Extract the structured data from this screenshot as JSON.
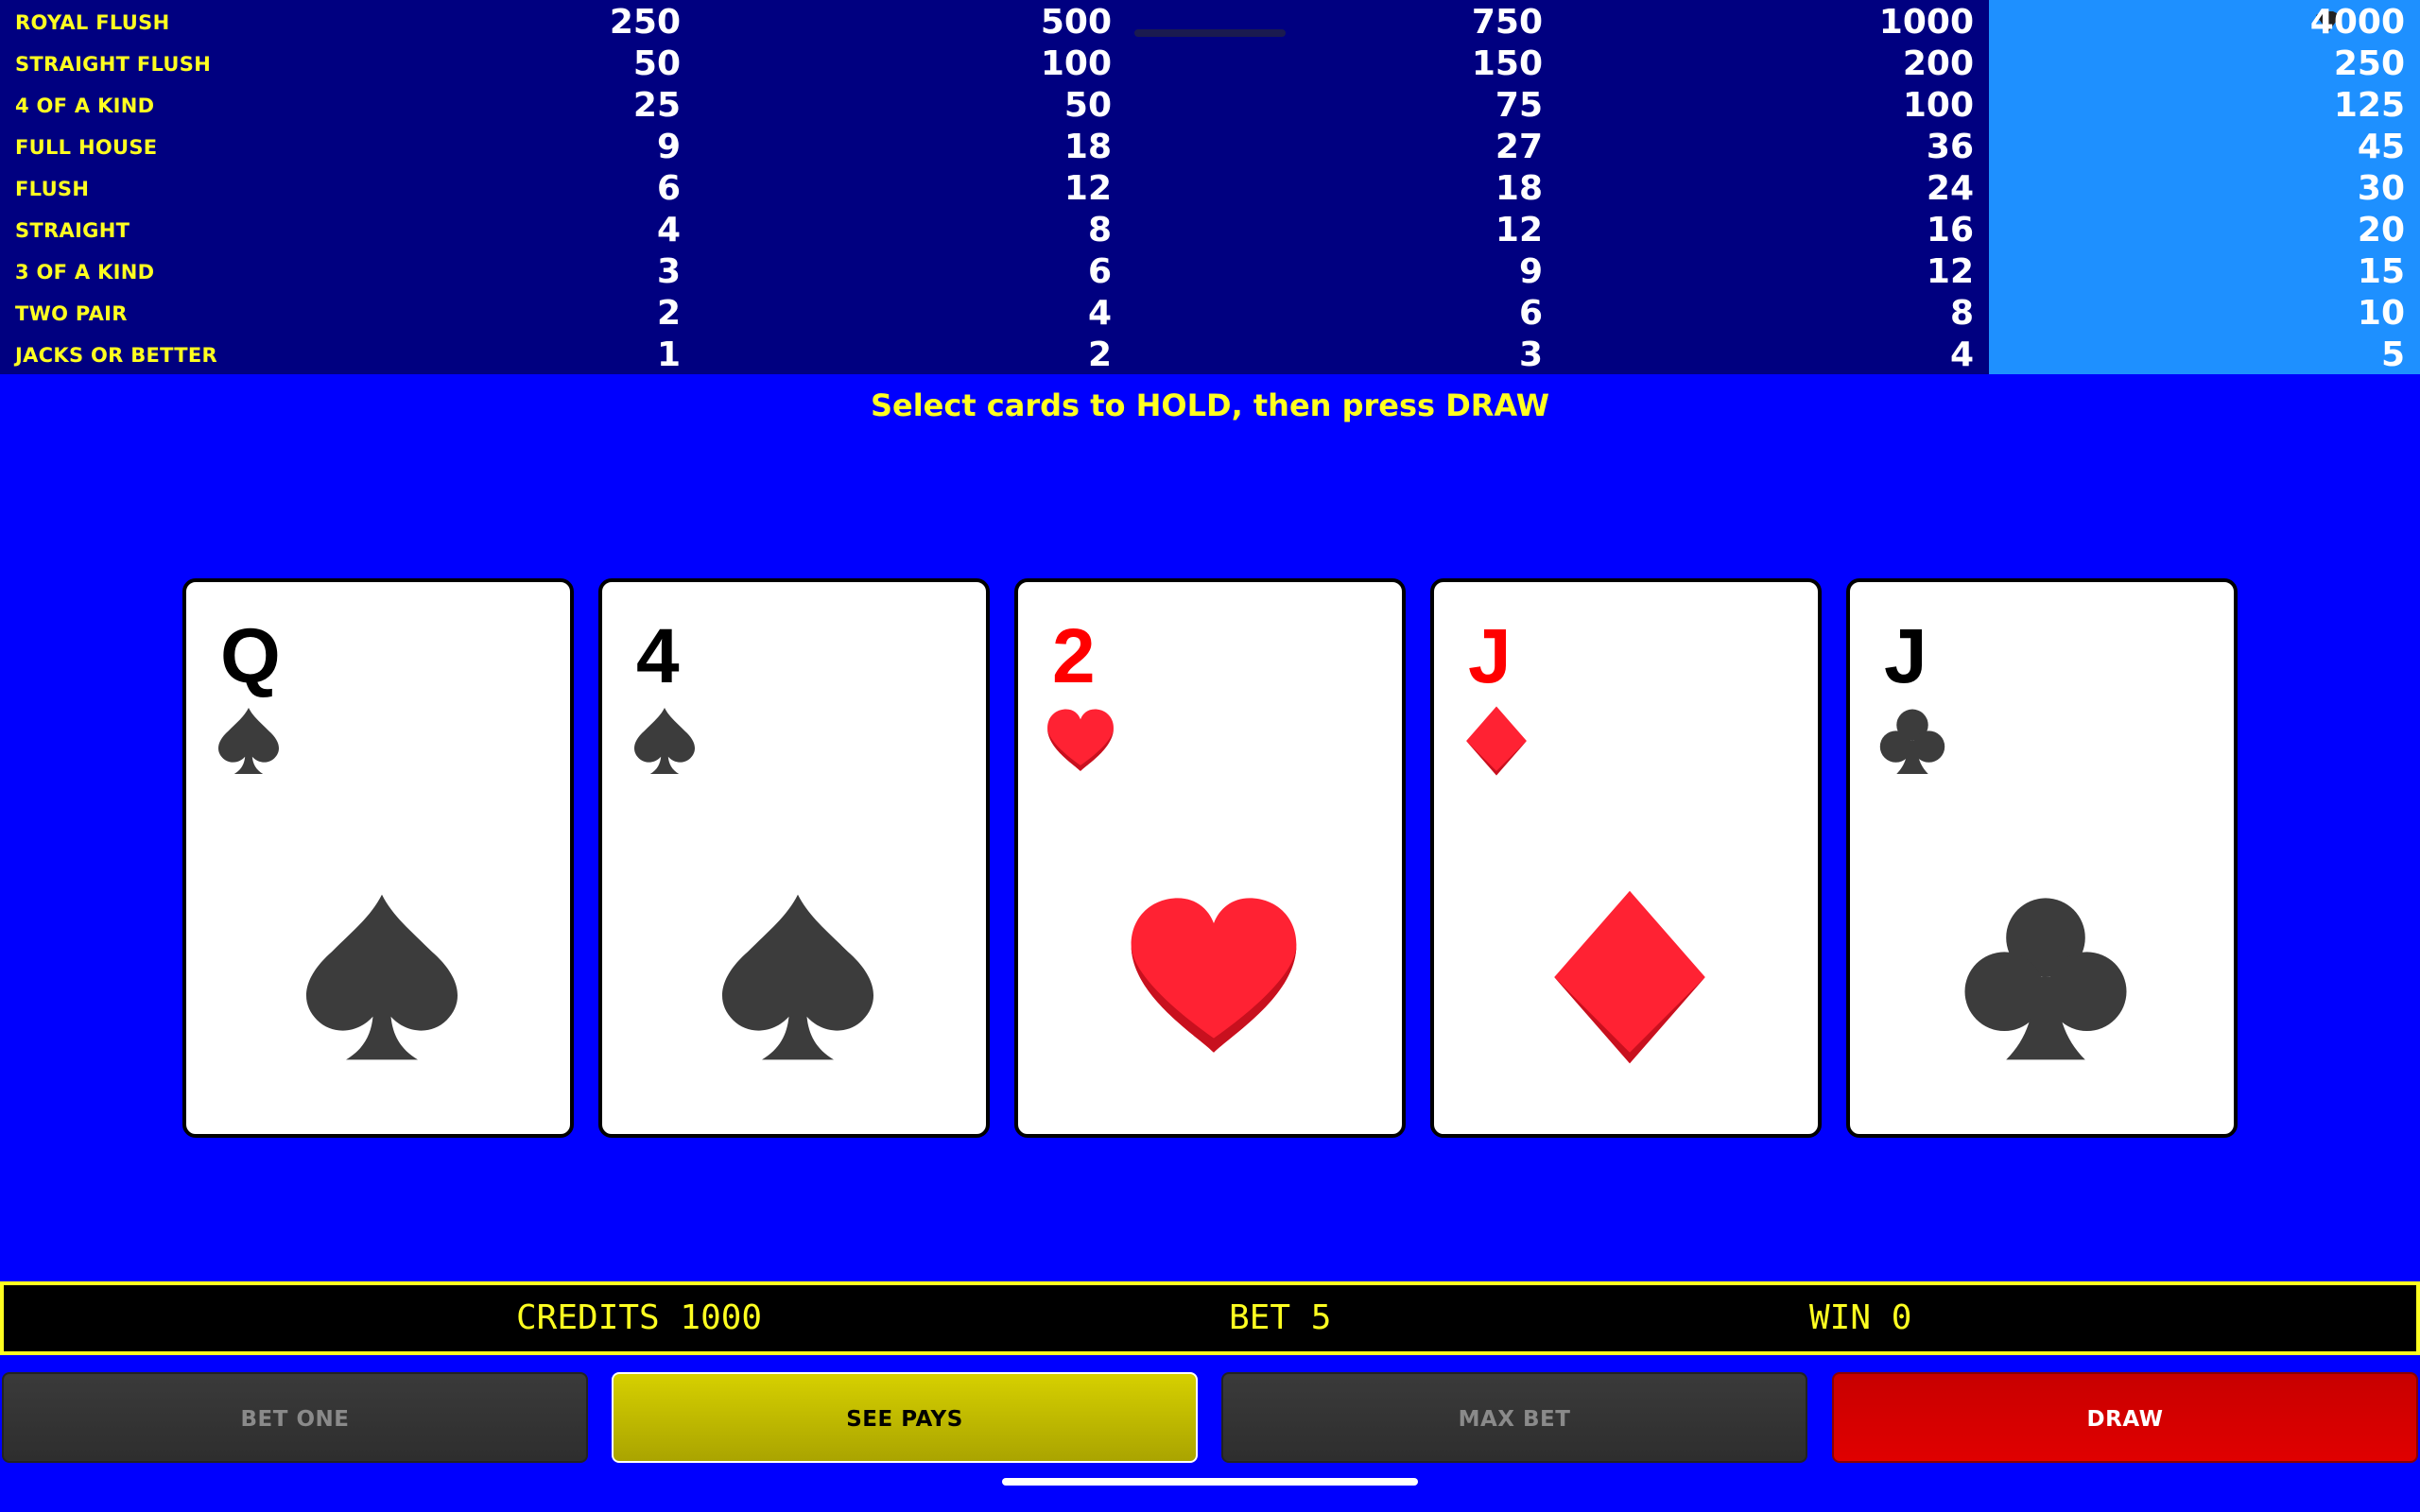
{
  "paytable": {
    "rows": [
      {
        "hand": "ROYAL FLUSH",
        "pays": [
          "250",
          "500",
          "750",
          "1000",
          "4000"
        ]
      },
      {
        "hand": "STRAIGHT FLUSH",
        "pays": [
          "50",
          "100",
          "150",
          "200",
          "250"
        ]
      },
      {
        "hand": "4 OF A KIND",
        "pays": [
          "25",
          "50",
          "75",
          "100",
          "125"
        ]
      },
      {
        "hand": "FULL HOUSE",
        "pays": [
          "9",
          "18",
          "27",
          "36",
          "45"
        ]
      },
      {
        "hand": "FLUSH",
        "pays": [
          "6",
          "12",
          "18",
          "24",
          "30"
        ]
      },
      {
        "hand": "STRAIGHT",
        "pays": [
          "4",
          "8",
          "12",
          "16",
          "20"
        ]
      },
      {
        "hand": "3 OF A KIND",
        "pays": [
          "3",
          "6",
          "9",
          "12",
          "15"
        ]
      },
      {
        "hand": "TWO PAIR",
        "pays": [
          "2",
          "4",
          "6",
          "8",
          "10"
        ]
      },
      {
        "hand": "JACKS OR BETTER",
        "pays": [
          "1",
          "2",
          "3",
          "4",
          "5"
        ]
      }
    ],
    "highlighted_column": 5
  },
  "message": "Select cards to HOLD, then press DRAW",
  "cards": [
    {
      "rank": "Q",
      "suit": "spade-icon",
      "color": "#000000"
    },
    {
      "rank": "4",
      "suit": "spade-icon",
      "color": "#000000"
    },
    {
      "rank": "2",
      "suit": "heart-icon",
      "color": "#ff0000"
    },
    {
      "rank": "J",
      "suit": "diamond-icon",
      "color": "#ff0000"
    },
    {
      "rank": "J",
      "suit": "club-icon",
      "color": "#000000"
    }
  ],
  "status": {
    "credits_label": "CREDITS",
    "credits_value": "1000",
    "bet_label": "BET",
    "bet_value": "5",
    "win_label": "WIN",
    "win_value": "0"
  },
  "buttons": {
    "bet_one": "BET ONE",
    "see_pays": "SEE PAYS",
    "max_bet": "MAX BET",
    "draw": "DRAW"
  },
  "colors": {
    "background": "#0000fe",
    "paytable_bg": "#000080",
    "highlight_column": "#1e90ff",
    "text_yellow": "#ffff20"
  }
}
